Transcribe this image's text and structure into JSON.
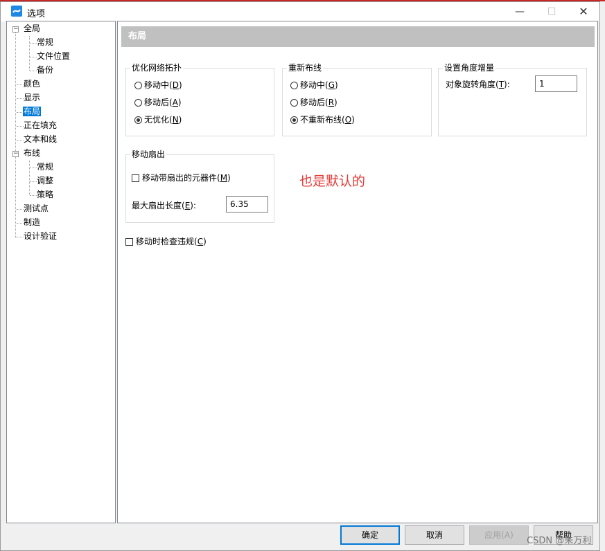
{
  "window": {
    "title": "选项"
  },
  "tree": [
    {
      "label": "全局"
    },
    {
      "label": "常规"
    },
    {
      "label": "文件位置"
    },
    {
      "label": "备份"
    },
    {
      "label": "颜色"
    },
    {
      "label": "显示"
    },
    {
      "label": "布局",
      "selected": true
    },
    {
      "label": "正在填充"
    },
    {
      "label": "文本和线"
    },
    {
      "label": "布线"
    },
    {
      "label": "常规"
    },
    {
      "label": "调整"
    },
    {
      "label": "策略"
    },
    {
      "label": "测试点"
    },
    {
      "label": "制造"
    },
    {
      "label": "设计验证"
    }
  ],
  "section": {
    "title": "布局"
  },
  "optimize": {
    "title": "优化网络拓扑",
    "options": [
      {
        "text": "移动中(",
        "key": "D",
        "end": ")",
        "checked": false
      },
      {
        "text": "移动后(",
        "key": "A",
        "end": ")",
        "checked": false
      },
      {
        "text": "无优化(",
        "key": "N",
        "end": ")",
        "checked": true
      }
    ]
  },
  "reroute": {
    "title": "重新布线",
    "options": [
      {
        "text": "移动中(",
        "key": "G",
        "end": ")",
        "checked": false
      },
      {
        "text": "移动后(",
        "key": "R",
        "end": ")",
        "checked": false
      },
      {
        "text": "不重新布线(",
        "key": "O",
        "end": ")",
        "checked": true
      }
    ]
  },
  "angle": {
    "title": "设置角度增量",
    "label_text": "对象旋转角度(",
    "label_key": "T",
    "label_end": "):",
    "value": "1"
  },
  "fanout": {
    "title": "移动扇出",
    "check_text": "移动带扇出的元器件(",
    "check_key": "M",
    "check_end": ")",
    "len_text": "最大扇出长度(",
    "len_key": "E",
    "len_end": "):",
    "len_value": "6.35"
  },
  "drc": {
    "text": "移动时检查违规(",
    "key": "C",
    "end": ")"
  },
  "annotation": "也是默认的",
  "buttons": {
    "ok": "确定",
    "cancel": "取消",
    "apply": "应用(A)",
    "help": "帮助"
  },
  "watermark": "CSDN @朱万利"
}
